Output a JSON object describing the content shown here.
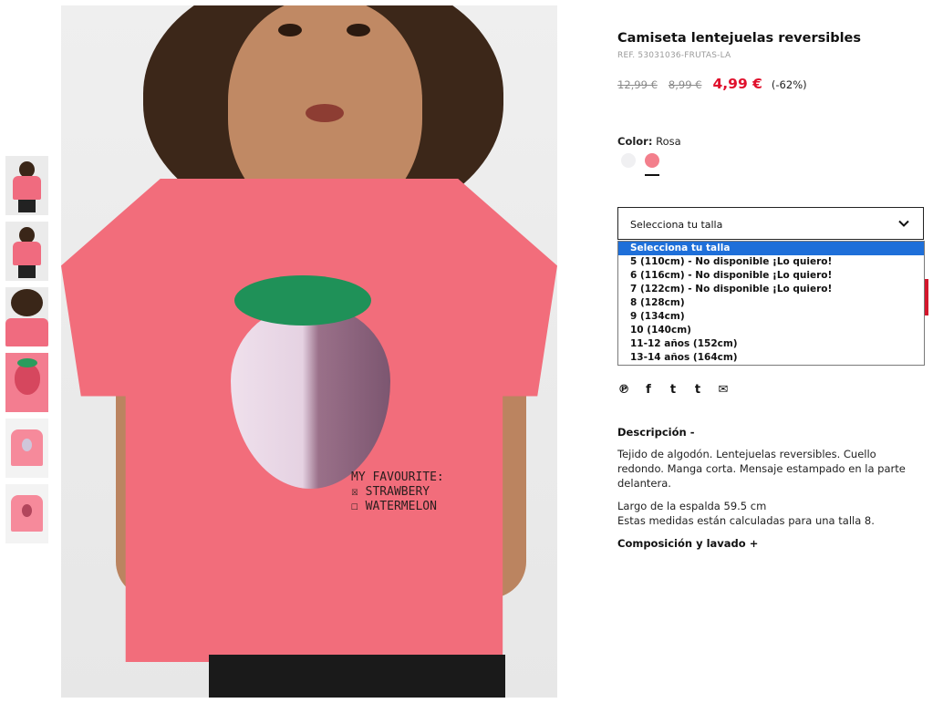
{
  "product": {
    "title": "Camiseta lentejuelas reversibles",
    "ref": "REF. 53031036-FRUTAS-LA",
    "price_original": "12,99 €",
    "price_previous": "8,99 €",
    "price_current": "4,99 €",
    "discount": "(-62%)"
  },
  "color": {
    "label": "Color:",
    "value": "Rosa",
    "swatches": [
      {
        "name": "Blanco",
        "hex": "#f0f0f2"
      },
      {
        "name": "Rosa",
        "hex": "#f37f8c",
        "selected": true
      }
    ]
  },
  "size": {
    "placeholder": "Selecciona tu talla",
    "options": [
      "Selecciona tu talla",
      "5 (110cm) - No disponible ¡Lo quiero!",
      "6 (116cm) - No disponible ¡Lo quiero!",
      "7 (122cm) - No disponible ¡Lo quiero!",
      "8 (128cm)",
      "9 (134cm)",
      "10 (140cm)",
      "11-12 años (152cm)",
      "13-14 años (164cm)"
    ],
    "highlighted_index": 0
  },
  "share": {
    "icons": [
      "pinterest-icon",
      "facebook-icon",
      "twitter-icon",
      "tumblr-icon",
      "email-icon"
    ],
    "glyphs": [
      "℗",
      "f",
      "t",
      "t",
      "✉"
    ]
  },
  "description": {
    "heading": "Descripción -",
    "paragraph1": "Tejido de algodón. Lentejuelas reversibles. Cuello redondo. Manga corta. Mensaje estampado en la parte delantera.",
    "paragraph2_line1": "Largo de la espalda 59.5 cm",
    "paragraph2_line2": "Estas medidas están calculadas para una talla 8."
  },
  "composition": {
    "heading": "Composición y lavado +"
  },
  "image": {
    "print_text": "MY FAVOURITE:\n☒ STRAWBERY\n☐ WATERMELON"
  },
  "colors": {
    "sale_red": "#e0102c",
    "highlight_blue": "#1e6fd9",
    "shirt_pink": "#f26d7b"
  }
}
